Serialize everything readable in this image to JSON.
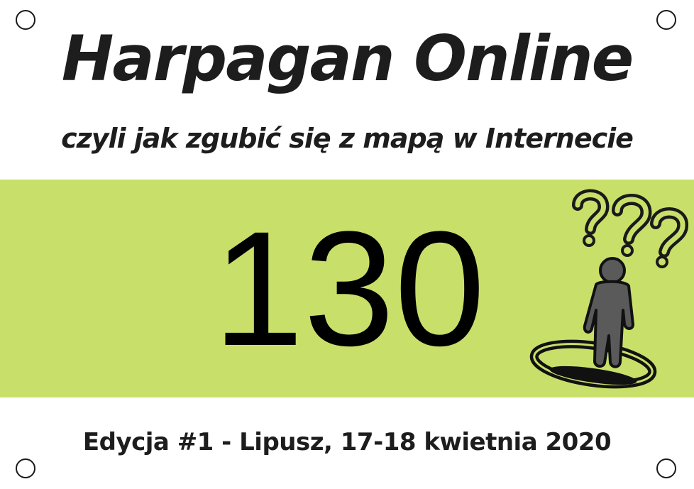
{
  "title": "Harpagan Online",
  "subtitle": "czyli jak zgubić się z mapą w Internecie",
  "bib_number": "130",
  "footer": "Edycja #1 - Lipusz, 17-18 kwietnia 2020",
  "colors": {
    "band": "#c8e06a",
    "text": "#1d1d1d",
    "figure": "#5a5a5a"
  },
  "icons": [
    "question-marks-icon",
    "lost-person-icon",
    "punch-hole-icon"
  ]
}
